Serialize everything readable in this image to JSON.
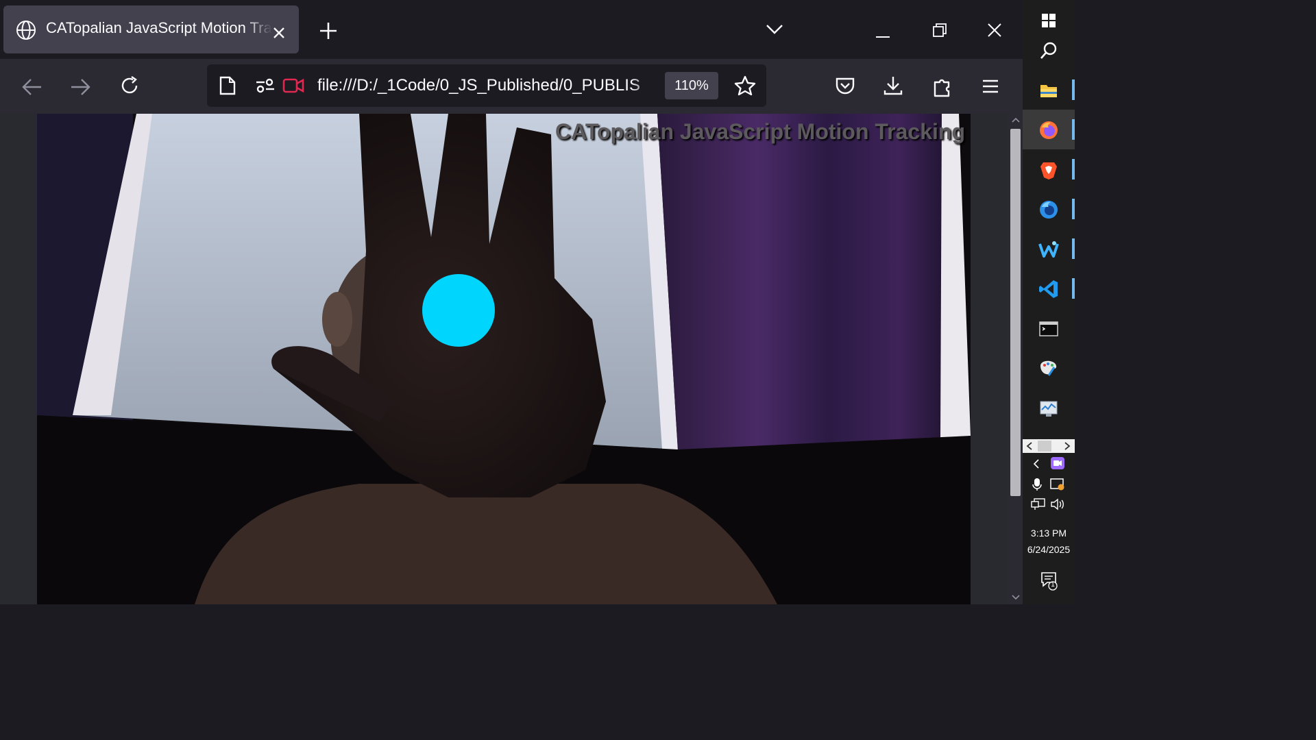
{
  "browser": {
    "tab": {
      "title": "CATopalian JavaScript Motion Tracking"
    },
    "url": "file:///D:/_1Code/0_JS_Published/0_PUBLIS",
    "zoom": "110%"
  },
  "page": {
    "title": "CATopalian JavaScript Motion Tracking",
    "tracker_color": "#00d5fe",
    "scroll_position": 0
  },
  "taskbar": {
    "apps": [
      "windows-start-icon",
      "search-icon",
      "file-explorer-icon",
      "firefox-icon",
      "brave-icon",
      "firefox-developer-icon",
      "waterfox-icon",
      "vscode-icon",
      "terminal-icon",
      "paint-icon",
      "performance-monitor-icon"
    ],
    "clock": {
      "time": "3:13 PM",
      "date": "6/24/2025"
    },
    "notifications_count": "1"
  },
  "colors": {
    "accent": "#00d5fe",
    "tab_bg": "#42414d",
    "toolbar_bg": "#2b2a33"
  }
}
